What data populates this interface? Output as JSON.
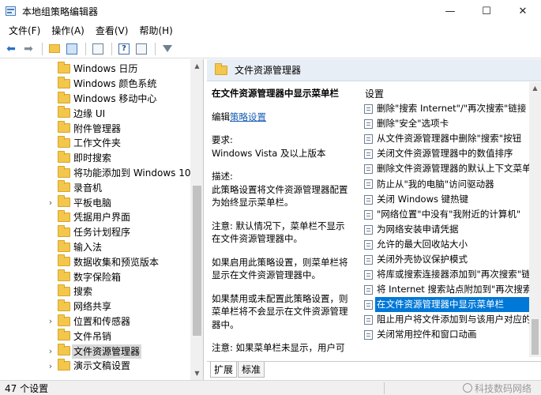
{
  "window": {
    "title": "本地组策略编辑器",
    "minimize_glyph": "—",
    "maximize_glyph": "☐",
    "close_glyph": "✕"
  },
  "menu": [
    {
      "label": "文件(F)"
    },
    {
      "label": "操作(A)"
    },
    {
      "label": "查看(V)"
    },
    {
      "label": "帮助(H)"
    }
  ],
  "toolbar": {
    "icons": [
      "back-arrow-icon",
      "forward-arrow-icon",
      "up-folder-icon",
      "show-hide-tree-icon",
      "export-list-icon",
      "help-icon",
      "properties-icon",
      "filter-icon"
    ]
  },
  "tree": {
    "items": [
      {
        "label": "Windows 日历",
        "expandable": false
      },
      {
        "label": "Windows 颜色系统",
        "expandable": false
      },
      {
        "label": "Windows 移动中心",
        "expandable": false
      },
      {
        "label": "边缘 UI",
        "expandable": false
      },
      {
        "label": "附件管理器",
        "expandable": false
      },
      {
        "label": "工作文件夹",
        "expandable": false
      },
      {
        "label": "即时搜索",
        "expandable": false
      },
      {
        "label": "将功能添加到 Windows 10",
        "expandable": false
      },
      {
        "label": "录音机",
        "expandable": false
      },
      {
        "label": "平板电脑",
        "expandable": true
      },
      {
        "label": "凭据用户界面",
        "expandable": false
      },
      {
        "label": "任务计划程序",
        "expandable": false
      },
      {
        "label": "输入法",
        "expandable": false
      },
      {
        "label": "数据收集和预览版本",
        "expandable": false
      },
      {
        "label": "数字保险箱",
        "expandable": false
      },
      {
        "label": "搜索",
        "expandable": false
      },
      {
        "label": "网络共享",
        "expandable": false
      },
      {
        "label": "位置和传感器",
        "expandable": true
      },
      {
        "label": "文件吊销",
        "expandable": false
      },
      {
        "label": "文件资源管理器",
        "expandable": true,
        "selected": true
      },
      {
        "label": "演示文稿设置",
        "expandable": true
      }
    ]
  },
  "right_header": {
    "title": "文件资源管理器"
  },
  "description": {
    "title": "在文件资源管理器中显示菜单栏",
    "edit_prefix": "编辑",
    "edit_link": "策略设置",
    "requirements_label": "要求:",
    "requirements_value": "Windows Vista 及以上版本",
    "desc_label": "描述:",
    "desc_text": "此策略设置将文件资源管理器配置为始终显示菜单栏。",
    "note1": "注意: 默认情况下，菜单栏不显示在文件资源管理器中。",
    "enabled_text": "如果启用此策略设置，则菜单栏将显示在文件资源管理器中。",
    "disabled_text": "如果禁用或未配置此策略设置，则菜单栏将不会显示在文件资源管理器中。",
    "note2": "注意: 如果菜单栏未显示，用户可"
  },
  "settings": {
    "header": "设置",
    "items": [
      {
        "label": "删除\"搜索 Internet\"/\"再次搜索\"链接"
      },
      {
        "label": "删除\"安全\"选项卡"
      },
      {
        "label": "从文件资源管理器中删除\"搜索\"按钮"
      },
      {
        "label": "关闭文件资源管理器中的数值排序"
      },
      {
        "label": "删除文件资源管理器的默认上下文菜单"
      },
      {
        "label": "防止从\"我的电脑\"访问驱动器"
      },
      {
        "label": "关闭 Windows 键热键"
      },
      {
        "label": "\"网络位置\"中没有\"我附近的计算机\""
      },
      {
        "label": "为网络安装申请凭据"
      },
      {
        "label": "允许的最大回收站大小"
      },
      {
        "label": "关闭外壳协议保护模式"
      },
      {
        "label": "将库或搜索连接器添加到\"再次搜索\"链接"
      },
      {
        "label": "将 Internet 搜索站点附加到\"再次搜索\"链接"
      },
      {
        "label": "在文件资源管理器中显示菜单栏",
        "selected": true
      },
      {
        "label": "阻止用户将文件添加到与该用户对应的\"用户文件"
      },
      {
        "label": "关闭常用控件和窗口动画"
      }
    ]
  },
  "tabs": [
    {
      "label": "扩展",
      "active": true
    },
    {
      "label": "标准",
      "active": false
    }
  ],
  "status": {
    "count_text": "47 个设置",
    "watermark": "科技数码网络"
  }
}
